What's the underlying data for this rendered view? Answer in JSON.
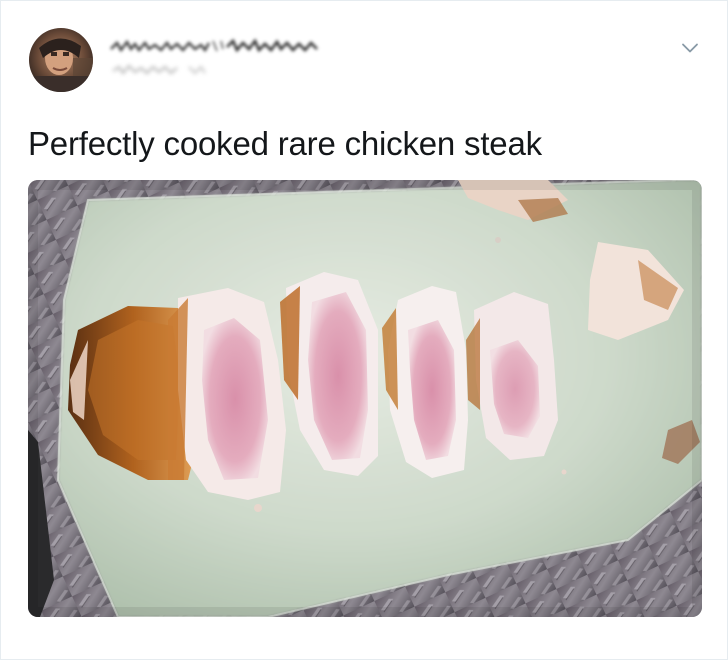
{
  "tweet": {
    "text": "Perfectly cooked rare chicken steak",
    "author": {
      "name_obscured": true,
      "handle_obscured": true
    }
  },
  "icons": {
    "avatar": "avatar-photo",
    "menu": "chevron-down-icon"
  },
  "colors": {
    "text": "#14171a",
    "secondary": "#657786",
    "border": "#e6ecf0",
    "background": "#ffffff",
    "chicken_pink": "#df9bb1",
    "chicken_white": "#f4eded",
    "cutting_board": "#c9d8c8",
    "metal": "#8e8a90"
  },
  "media": {
    "type": "photo",
    "subject": "sliced chicken on cutting board"
  }
}
